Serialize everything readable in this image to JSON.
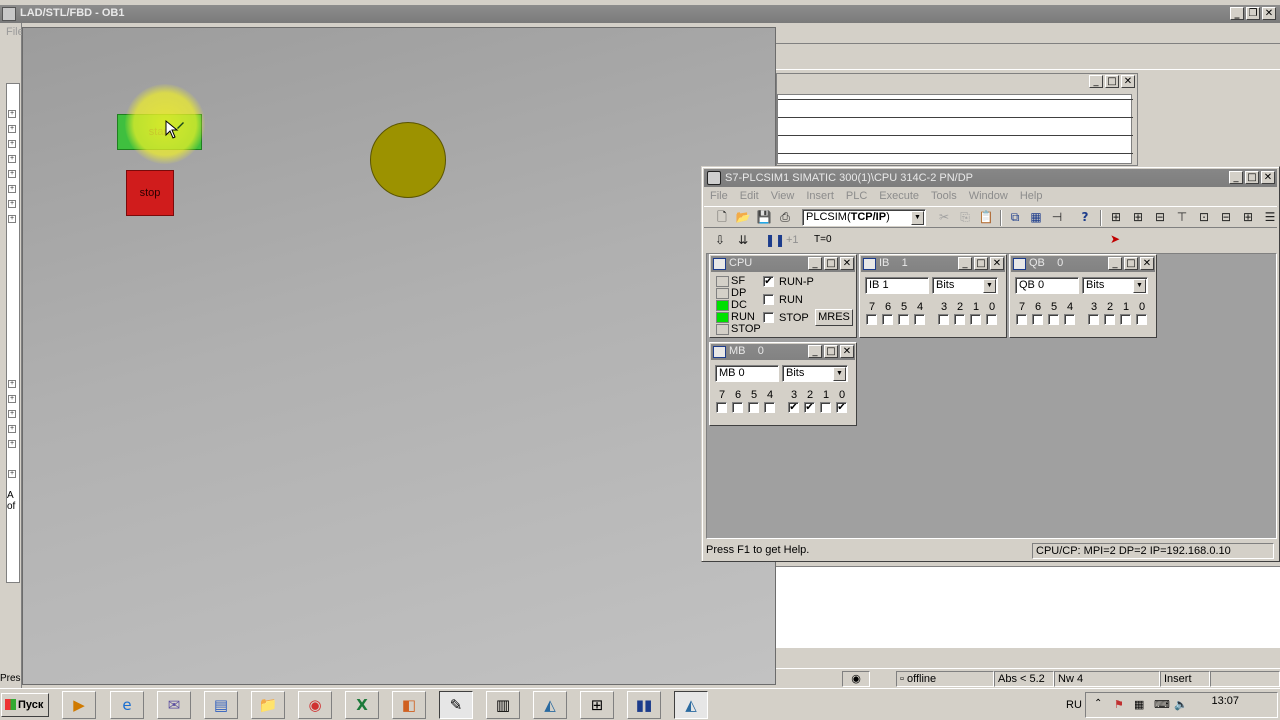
{
  "lad_window": {
    "title": "LAD/STL/FBD - OB1",
    "menu_first": "File",
    "status_prefix": "Pres",
    "bottom_text_1": "A",
    "bottom_text_2": "of"
  },
  "hmi": {
    "start_label": "start",
    "stop_label": "stop",
    "colors": {
      "start": "#3fbf3f",
      "stop": "#d01c1c",
      "lamp": "#9c9200",
      "cursor_highlight": "#f0f028"
    }
  },
  "editor_status": {
    "mode": "offline",
    "abs": "Abs < 5.2",
    "nw": "Nw 4",
    "insert": "Insert"
  },
  "plcsim": {
    "title": "S7-PLCSIM1    SIMATIC 300(1)\\CPU 314C-2 PN/DP",
    "menu": [
      "File",
      "Edit",
      "View",
      "Insert",
      "PLC",
      "Execute",
      "Tools",
      "Window",
      "Help"
    ],
    "interface": "PLCSIM(TCP/IP)",
    "interface_bold": "TCP/IP",
    "t0_label": "T=0",
    "plus1_label": "+1",
    "status_help": "Press F1 to get Help.",
    "status_conn": "CPU/CP:  MPI=2 DP=2 IP=192.168.0.10",
    "cpu": {
      "title": "CPU",
      "leds": [
        {
          "label": "SF",
          "on": false
        },
        {
          "label": "DP",
          "on": false
        },
        {
          "label": "DC",
          "on": true
        },
        {
          "label": "RUN",
          "on": true
        },
        {
          "label": "STOP",
          "on": false
        }
      ],
      "modes": [
        {
          "label": "RUN-P",
          "checked": true
        },
        {
          "label": "RUN",
          "checked": false
        },
        {
          "label": "STOP",
          "checked": false
        }
      ],
      "mres_label": "MRES"
    },
    "ib": {
      "title": "IB    1",
      "address": "IB    1",
      "format": "Bits",
      "bits_high": [
        "7",
        "6",
        "5",
        "4"
      ],
      "bits_low": [
        "3",
        "2",
        "1",
        "0"
      ],
      "states": [
        false,
        false,
        false,
        false,
        false,
        false,
        false,
        false
      ]
    },
    "qb": {
      "title": "QB    0",
      "address": "QB    0",
      "format": "Bits",
      "bits_high": [
        "7",
        "6",
        "5",
        "4"
      ],
      "bits_low": [
        "3",
        "2",
        "1",
        "0"
      ],
      "states": [
        false,
        false,
        false,
        false,
        false,
        false,
        false,
        false
      ]
    },
    "mb": {
      "title": "MB    0",
      "address": "MB    0",
      "format": "Bits",
      "bits_high": [
        "7",
        "6",
        "5",
        "4"
      ],
      "bits_low": [
        "3",
        "2",
        "1",
        "0"
      ],
      "states": [
        false,
        false,
        false,
        false,
        true,
        true,
        false,
        true
      ]
    }
  },
  "taskbar": {
    "start_label": "Пуск",
    "lang": "RU",
    "clock": "13:07"
  }
}
